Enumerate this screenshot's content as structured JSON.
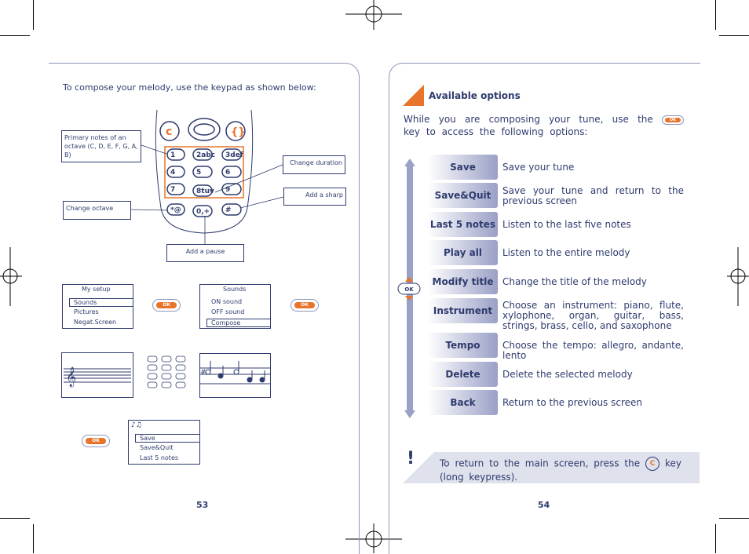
{
  "left_page": {
    "intro": "To compose your melody, use the keypad as shown below:",
    "callouts": {
      "primary_notes": "Primary notes of an octave (C, D, E, F, G, A, B)",
      "change_duration": "Change duration",
      "add_sharp": "Add a sharp",
      "change_octave": "Change octave",
      "add_pause": "Add a pause"
    },
    "screen_setup": {
      "title": "My setup",
      "items": [
        "Sounds",
        "Pictures",
        "Negat.Screen"
      ],
      "selected": "Sounds"
    },
    "screen_sounds": {
      "title": "Sounds",
      "items": [
        "ON sound",
        "OFF sound",
        "Compose"
      ],
      "selected": "Compose"
    },
    "screen_options": {
      "items": [
        "Save",
        "Save&Quit",
        "Last 5 notes"
      ],
      "selected": "Save"
    },
    "ok_label": "OK",
    "page_number": "53"
  },
  "right_page": {
    "heading": "Available options",
    "intro_before": "While you are composing your tune, use the",
    "intro_after": "key to access the following options:",
    "ok_label": "OK",
    "options": [
      {
        "label": "Save",
        "desc": "Save your tune"
      },
      {
        "label": "Save&Quit",
        "desc": "Save your tune and return to the previous screen"
      },
      {
        "label": "Last 5 notes",
        "desc": "Listen to the last five notes"
      },
      {
        "label": "Play all",
        "desc": "Listen to the entire melody"
      },
      {
        "label": "Modify title",
        "desc": "Change the title of the melody"
      },
      {
        "label": "Instrument",
        "desc": "Choose an instrument: piano, flute, xylophone, organ, guitar, bass, strings, brass, cello, and saxophone"
      },
      {
        "label": "Tempo",
        "desc": "Choose the tempo: allegro, andante, lento"
      },
      {
        "label": "Delete",
        "desc": "Delete the selected melody"
      },
      {
        "label": "Back",
        "desc": "Return to the previous screen"
      }
    ],
    "note_mark": "!",
    "note_before": "To return to the main screen, press the",
    "note_after": "key (long keypress).",
    "c_key": "C",
    "page_number": "54"
  },
  "colors": {
    "text": "#2f3b6e",
    "accent": "#e8732a",
    "frame": "#8e95b8",
    "note_bg": "#dfe1ec"
  }
}
